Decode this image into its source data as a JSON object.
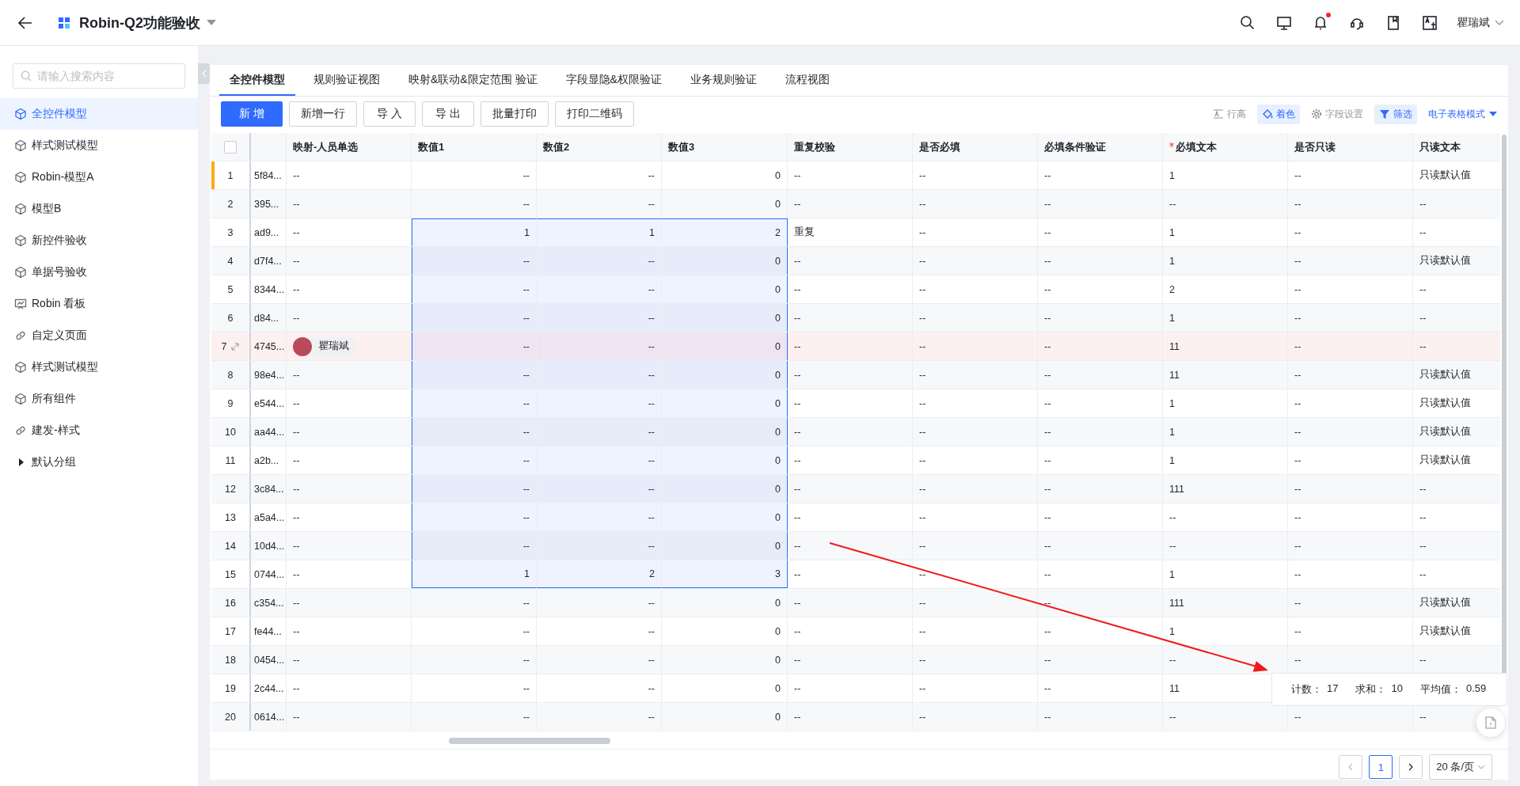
{
  "topbar": {
    "title": "Robin-Q2功能验收",
    "user": "瞿瑞斌",
    "notification_dot": true
  },
  "sidebar": {
    "search": {
      "placeholder": "请输入搜索内容"
    },
    "items": [
      {
        "label": "全控件模型",
        "kind": "model",
        "selected": true
      },
      {
        "label": "样式测试模型",
        "kind": "model",
        "selected": false
      },
      {
        "label": "Robin-模型A",
        "kind": "model",
        "selected": false
      },
      {
        "label": "模型B",
        "kind": "model",
        "selected": false
      },
      {
        "label": "新控件验收",
        "kind": "model",
        "selected": false
      },
      {
        "label": "单据号验收",
        "kind": "model",
        "selected": false
      },
      {
        "label": "Robin 看板",
        "kind": "board",
        "selected": false
      },
      {
        "label": "自定义页面",
        "kind": "link",
        "selected": false
      },
      {
        "label": "样式测试模型",
        "kind": "model",
        "selected": false
      },
      {
        "label": "所有组件",
        "kind": "model",
        "selected": false
      },
      {
        "label": "建发-样式",
        "kind": "link",
        "selected": false
      },
      {
        "label": "默认分组",
        "kind": "group",
        "selected": false
      }
    ]
  },
  "tabs": [
    {
      "label": "全控件模型",
      "selected": true
    },
    {
      "label": "规则验证视图",
      "selected": false
    },
    {
      "label": "映射&联动&限定范围 验证",
      "selected": false
    },
    {
      "label": "字段显隐&权限验证",
      "selected": false
    },
    {
      "label": "业务规则验证",
      "selected": false
    },
    {
      "label": "流程视图",
      "selected": false
    }
  ],
  "toolbar": {
    "buttons": [
      {
        "label": "新 增",
        "kind": "primary"
      },
      {
        "label": "新增一行",
        "kind": "default"
      },
      {
        "label": "导 入",
        "kind": "default"
      },
      {
        "label": "导 出",
        "kind": "default"
      },
      {
        "label": "批量打印",
        "kind": "default"
      },
      {
        "label": "打印二维码",
        "kind": "default"
      }
    ],
    "tools": [
      {
        "label": "行高",
        "kind": "row-height",
        "active": false
      },
      {
        "label": "着色",
        "kind": "color",
        "active": true
      },
      {
        "label": "字段设置",
        "kind": "settings",
        "active": false
      },
      {
        "label": "筛选",
        "kind": "filter",
        "active": true
      }
    ],
    "mode": "电子表格模式"
  },
  "table": {
    "select_all": {
      "checked": false
    },
    "columns": [
      {
        "label": "映射-人员单选",
        "kind": "person",
        "required": false
      },
      {
        "label": "数值1",
        "kind": "number",
        "required": false
      },
      {
        "label": "数值2",
        "kind": "number",
        "required": false
      },
      {
        "label": "数值3",
        "kind": "number",
        "required": false
      },
      {
        "label": "重复校验",
        "kind": "text",
        "required": false
      },
      {
        "label": "是否必填",
        "kind": "text",
        "required": false
      },
      {
        "label": "必填条件验证",
        "kind": "text",
        "required": false
      },
      {
        "label": "必填文本",
        "kind": "text",
        "required": true
      },
      {
        "label": "是否只读",
        "kind": "text",
        "required": false
      },
      {
        "label": "只读文本",
        "kind": "text",
        "required": false
      }
    ],
    "rows": [
      {
        "number": "1",
        "id": "5f84...",
        "marked": true,
        "highlighted": false,
        "range_selected": false,
        "cells": [
          "--",
          "--",
          "--",
          "0",
          "--",
          "--",
          "--",
          "1",
          "--",
          "只读默认值"
        ]
      },
      {
        "number": "2",
        "id": "395...",
        "marked": false,
        "highlighted": false,
        "range_selected": false,
        "cells": [
          "--",
          "--",
          "--",
          "0",
          "--",
          "--",
          "--",
          "--",
          "--",
          "--"
        ]
      },
      {
        "number": "3",
        "id": "ad9...",
        "marked": false,
        "highlighted": false,
        "range_selected": true,
        "cells": [
          "--",
          "1",
          "1",
          "2",
          "重复",
          "--",
          "--",
          "1",
          "--",
          "--"
        ]
      },
      {
        "number": "4",
        "id": "d7f4...",
        "marked": false,
        "highlighted": false,
        "range_selected": true,
        "cells": [
          "--",
          "--",
          "--",
          "0",
          "--",
          "--",
          "--",
          "1",
          "--",
          "只读默认值"
        ]
      },
      {
        "number": "5",
        "id": "8344...",
        "marked": false,
        "highlighted": false,
        "range_selected": true,
        "cells": [
          "--",
          "--",
          "--",
          "0",
          "--",
          "--",
          "--",
          "2",
          "--",
          "--"
        ]
      },
      {
        "number": "6",
        "id": "d84...",
        "marked": false,
        "highlighted": false,
        "range_selected": true,
        "cells": [
          "--",
          "--",
          "--",
          "0",
          "--",
          "--",
          "--",
          "1",
          "--",
          "--"
        ]
      },
      {
        "number": "7",
        "id": "4745...",
        "marked": false,
        "highlighted": true,
        "range_selected": true,
        "cells": [
          {
            "name": "瞿瑞斌"
          },
          "--",
          "--",
          "0",
          "--",
          "--",
          "--",
          "11",
          "--",
          "--"
        ]
      },
      {
        "number": "8",
        "id": "98e4...",
        "marked": false,
        "highlighted": false,
        "range_selected": true,
        "cells": [
          "--",
          "--",
          "--",
          "0",
          "--",
          "--",
          "--",
          "11",
          "--",
          "只读默认值"
        ]
      },
      {
        "number": "9",
        "id": "e544...",
        "marked": false,
        "highlighted": false,
        "range_selected": true,
        "cells": [
          "--",
          "--",
          "--",
          "0",
          "--",
          "--",
          "--",
          "1",
          "--",
          "只读默认值"
        ]
      },
      {
        "number": "10",
        "id": "aa44...",
        "marked": false,
        "highlighted": false,
        "range_selected": true,
        "cells": [
          "--",
          "--",
          "--",
          "0",
          "--",
          "--",
          "--",
          "1",
          "--",
          "只读默认值"
        ]
      },
      {
        "number": "11",
        "id": "a2b...",
        "marked": false,
        "highlighted": false,
        "range_selected": true,
        "cells": [
          "--",
          "--",
          "--",
          "0",
          "--",
          "--",
          "--",
          "1",
          "--",
          "只读默认值"
        ]
      },
      {
        "number": "12",
        "id": "3c84...",
        "marked": false,
        "highlighted": false,
        "range_selected": true,
        "cells": [
          "--",
          "--",
          "--",
          "0",
          "--",
          "--",
          "--",
          "111",
          "--",
          "--"
        ]
      },
      {
        "number": "13",
        "id": "a5a4...",
        "marked": false,
        "highlighted": false,
        "range_selected": true,
        "cells": [
          "--",
          "--",
          "--",
          "0",
          "--",
          "--",
          "--",
          "--",
          "--",
          "--"
        ]
      },
      {
        "number": "14",
        "id": "10d4...",
        "marked": false,
        "highlighted": false,
        "range_selected": true,
        "cells": [
          "--",
          "--",
          "--",
          "0",
          "--",
          "--",
          "--",
          "--",
          "--",
          "--"
        ]
      },
      {
        "number": "15",
        "id": "0744...",
        "marked": false,
        "highlighted": false,
        "range_selected": true,
        "cells": [
          "--",
          "1",
          "2",
          "3",
          "--",
          "--",
          "--",
          "1",
          "--",
          "--"
        ]
      },
      {
        "number": "16",
        "id": "c354...",
        "marked": false,
        "highlighted": false,
        "range_selected": false,
        "cells": [
          "--",
          "--",
          "--",
          "0",
          "--",
          "--",
          "--",
          "111",
          "--",
          "只读默认值"
        ]
      },
      {
        "number": "17",
        "id": "fe44...",
        "marked": false,
        "highlighted": false,
        "range_selected": false,
        "cells": [
          "--",
          "--",
          "--",
          "0",
          "--",
          "--",
          "--",
          "1",
          "--",
          "只读默认值"
        ]
      },
      {
        "number": "18",
        "id": "0454...",
        "marked": false,
        "highlighted": false,
        "range_selected": false,
        "cells": [
          "--",
          "--",
          "--",
          "0",
          "--",
          "--",
          "--",
          "--",
          "--",
          "--"
        ]
      },
      {
        "number": "19",
        "id": "2c44...",
        "marked": false,
        "highlighted": false,
        "range_selected": false,
        "cells": [
          "--",
          "--",
          "--",
          "0",
          "--",
          "--",
          "--",
          "11",
          null,
          null
        ]
      },
      {
        "number": "20",
        "id": "0614...",
        "marked": false,
        "highlighted": false,
        "range_selected": false,
        "cells": [
          "--",
          "--",
          "--",
          "0",
          "--",
          "--",
          "--",
          "--",
          "--",
          "--"
        ]
      }
    ]
  },
  "stats": [
    {
      "label": "计数：",
      "value": "17"
    },
    {
      "label": "求和：",
      "value": "10"
    },
    {
      "label": "平均值：",
      "value": "0.59"
    }
  ],
  "pagination": {
    "pages": [
      {
        "label": "1",
        "selected": true
      }
    ],
    "page_size": "20 条/页"
  },
  "annotation": {
    "kind": "arrow"
  }
}
